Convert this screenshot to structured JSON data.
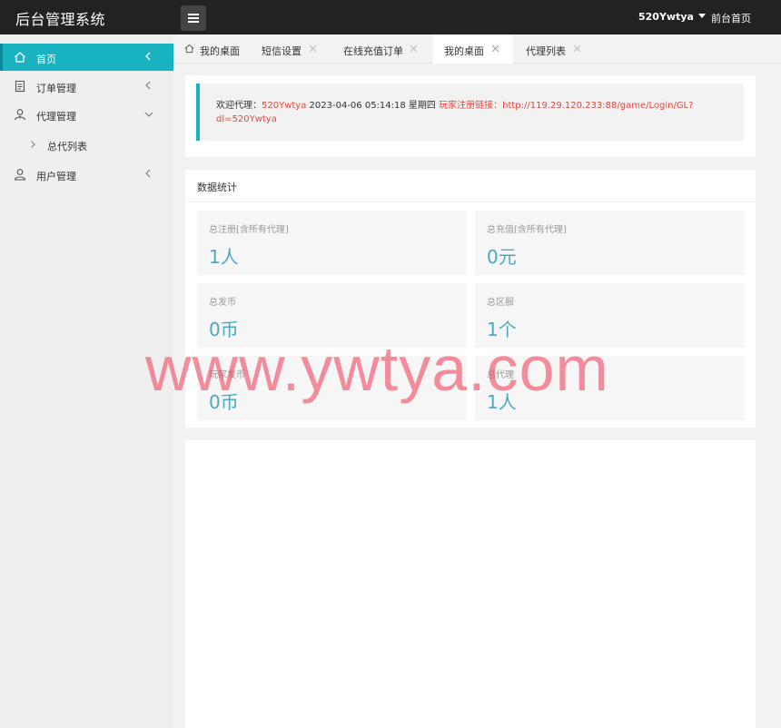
{
  "header": {
    "logo": "后台管理系统",
    "username": "520Ywtya",
    "front_link": "前台首页"
  },
  "sidebar": {
    "items": [
      {
        "label": "首页",
        "icon": "home-icon"
      },
      {
        "label": "订单管理",
        "icon": "order-icon"
      },
      {
        "label": "代理管理",
        "icon": "agent-icon"
      },
      {
        "label": "总代列表",
        "icon": "chevron-right-icon"
      },
      {
        "label": "用户管理",
        "icon": "user-icon"
      }
    ]
  },
  "tabs": [
    {
      "label": "我的桌面"
    },
    {
      "label": "短信设置"
    },
    {
      "label": "在线充值订单"
    },
    {
      "label": "我的桌面"
    },
    {
      "label": "代理列表"
    }
  ],
  "welcome": {
    "prefix": "欢迎代理：",
    "agent": "520Ywtya",
    "datetime": "2023-04-06  05:14:18  星期四",
    "link_label": "玩家注册链接：http://119.29.120.233:88/game/Login/GL?",
    "link_cont": "dl=520Ywtya"
  },
  "stats": {
    "title": "数据统计",
    "cards": [
      {
        "title": "总注册[含所有代理]",
        "value": "1人"
      },
      {
        "title": "总充值[含所有代理]",
        "value": "0元"
      },
      {
        "title": "总发币",
        "value": "0币"
      },
      {
        "title": "总区服",
        "value": "1个"
      },
      {
        "title": "玩家发币",
        "value": "0币"
      },
      {
        "title": "总代理",
        "value": "1人"
      }
    ]
  },
  "watermark": "www.ywtya.com",
  "colors": {
    "accent": "#19b2c0",
    "header": "#222222",
    "stat_value": "#4aa9c0",
    "link_red": "#e8463b"
  }
}
